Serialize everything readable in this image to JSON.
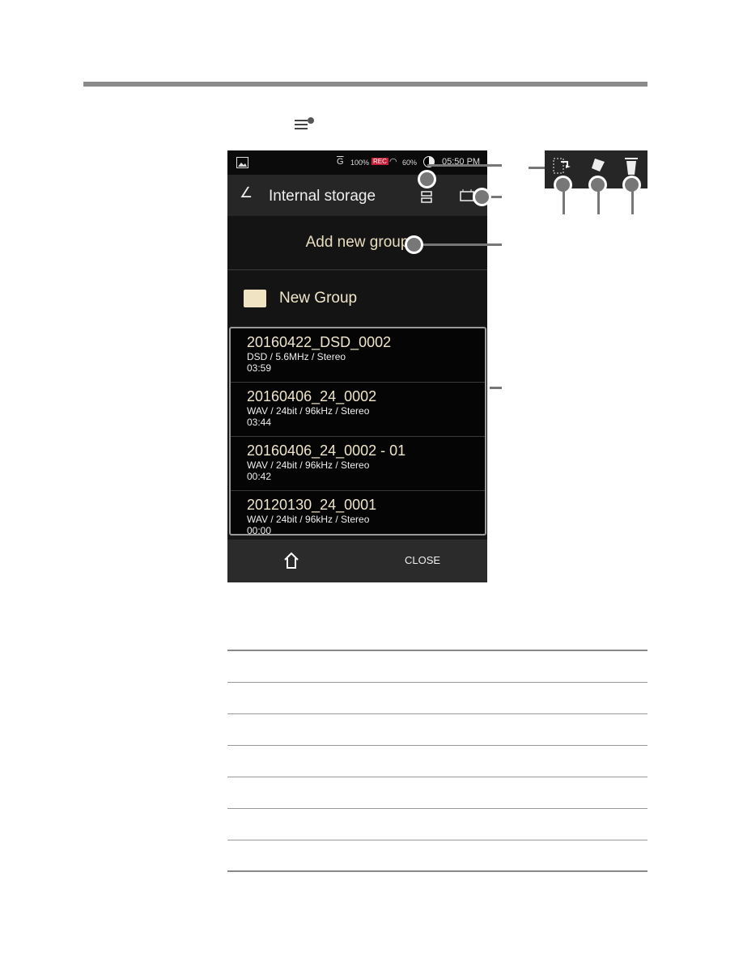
{
  "instruction_icon": "menu-icon",
  "status_bar": {
    "gain": "G",
    "battery": "100%",
    "rec": "REC",
    "wifi": "60%",
    "time": "05:50 PM"
  },
  "header": {
    "title": "Internal storage"
  },
  "add_group_label": "Add new group",
  "group": {
    "name": "New Group"
  },
  "files": [
    {
      "name": "20160422_DSD_0002",
      "format": "DSD / 5.6MHz / Stereo",
      "duration": "03:59"
    },
    {
      "name": "20160406_24_0002",
      "format": "WAV / 24bit / 96kHz / Stereo",
      "duration": "03:44"
    },
    {
      "name": "20160406_24_0002 - 01",
      "format": "WAV / 24bit / 96kHz / Stereo",
      "duration": "00:42"
    },
    {
      "name": "20120130_24_0001",
      "format": "WAV / 24bit / 96kHz / Stereo",
      "duration": "00:00"
    }
  ],
  "bottom": {
    "close_label": "CLOSE"
  },
  "edit_icons": [
    "move-icon",
    "rename-icon",
    "trash-icon"
  ]
}
